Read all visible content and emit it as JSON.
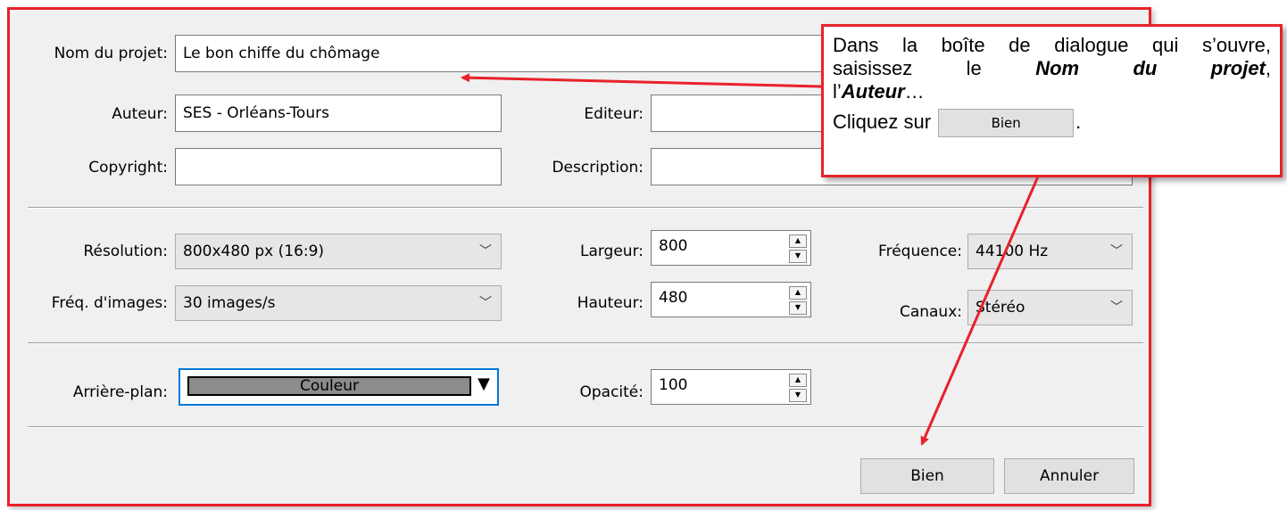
{
  "form": {
    "project_name": {
      "label": "Nom du projet:",
      "value": "Le bon chiffe du chômage"
    },
    "author": {
      "label": "Auteur:",
      "value": "SES - Orléans-Tours"
    },
    "editor": {
      "label": "Editeur:",
      "value": ""
    },
    "copyright": {
      "label": "Copyright:",
      "value": ""
    },
    "description": {
      "label": "Description:",
      "value": ""
    },
    "resolution": {
      "label": "Résolution:",
      "value": "800x480 px (16:9)"
    },
    "width": {
      "label": "Largeur:",
      "value": "800"
    },
    "frequency": {
      "label": "Fréquence:",
      "value": "44100 Hz"
    },
    "framerate": {
      "label": "Fréq. d'images:",
      "value": "30 images/s"
    },
    "height": {
      "label": "Hauteur:",
      "value": "480"
    },
    "channels": {
      "label": "Canaux:",
      "value": "Stéréo"
    },
    "background": {
      "label": "Arrière-plan:",
      "value": "Couleur",
      "swatch_color": "#8c8c8c"
    },
    "opacity": {
      "label": "Opacité:",
      "value": "100"
    }
  },
  "buttons": {
    "ok": "Bien",
    "cancel": "Annuler"
  },
  "callout": {
    "line1": "Dans la boîte de dialogue qui s’ouvre,",
    "line2_a": "saisissez le ",
    "line2_b": "Nom du projet",
    "line2_c": ",",
    "line3_a": "l’",
    "line3_b": "Auteur",
    "line3_c": "…",
    "line4_a": "Cliquez sur",
    "line4_btn": "Bien",
    "line4_c": "."
  },
  "colors": {
    "accent_red": "#e8212a",
    "focus_blue": "#0078d7"
  }
}
